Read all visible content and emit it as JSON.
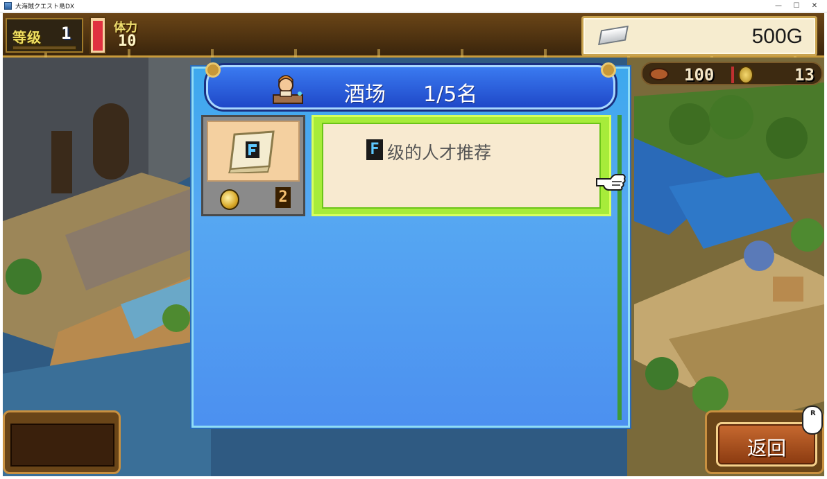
{
  "window": {
    "title": "大海賊クエスト島DX",
    "minimize": "—",
    "maximize": "☐",
    "close": "✕"
  },
  "hud": {
    "level_label": "等级",
    "level_value": "1",
    "hp_fill_fraction": 0.98,
    "stamina_label": "体力",
    "stamina_value": "10",
    "gold_value": "500G",
    "food_value": "100",
    "medal_value": "13"
  },
  "dialog": {
    "title": "酒场",
    "count": "1/5名",
    "item": {
      "grade": "F",
      "cost": "2",
      "description": "级的人才推荐"
    }
  },
  "buttons": {
    "back_label": "返回",
    "back_key": "R"
  },
  "colors": {
    "dialog_bg": "#56a8f2",
    "header_bg": "#1f48c8",
    "selection_border": "#a7ec3a",
    "back_button": "#a24e1e"
  }
}
